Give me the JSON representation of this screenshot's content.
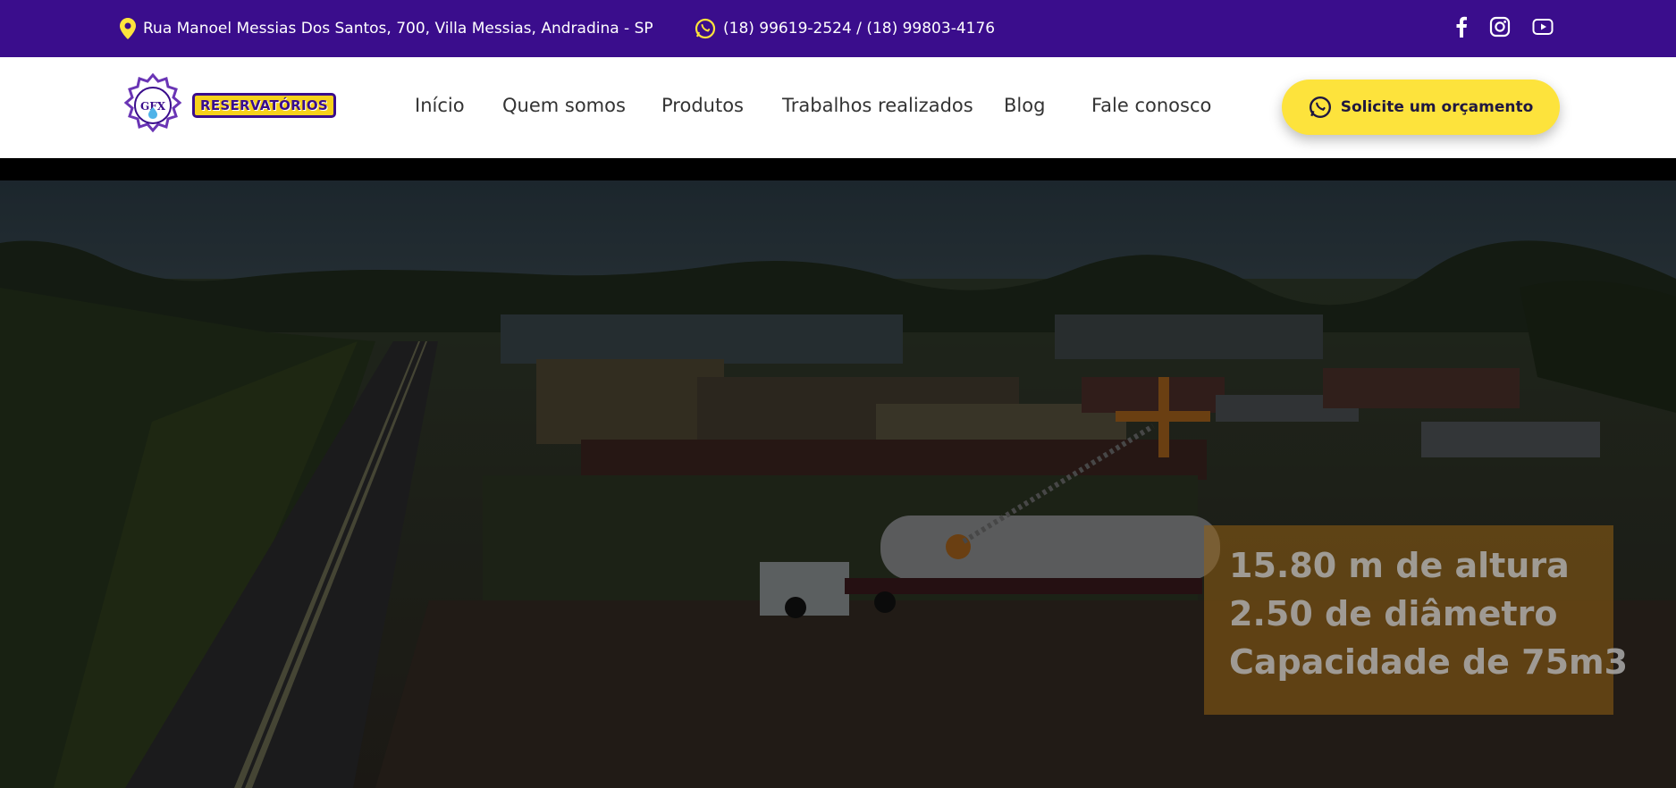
{
  "topbar": {
    "address": "Rua Manoel Messias Dos Santos, 700, Villa Messias, Andradina - SP",
    "phones": "(18) 99619-2524 / (18) 99803-4176",
    "icons": {
      "location": "map-pin-icon",
      "whatsapp": "whatsapp-icon",
      "facebook": "facebook-icon",
      "instagram": "instagram-icon",
      "youtube": "youtube-icon"
    }
  },
  "logo": {
    "emblem_text": "GFX",
    "wordmark": "RESERVATÓRIOS"
  },
  "nav": {
    "items": [
      "Início",
      "Quem somos",
      "Produtos",
      "Trabalhos realizados",
      "Blog",
      "Fale conosco"
    ]
  },
  "cta": {
    "label": "Solicite um orçamento"
  },
  "hero": {
    "specs": [
      "15.80 m de altura",
      "2.50 de diâmetro",
      "Capacidade de 75m3"
    ]
  },
  "colors": {
    "topbar": "#3a0d8c",
    "accent": "#fde33c",
    "overlay": "#946014"
  }
}
